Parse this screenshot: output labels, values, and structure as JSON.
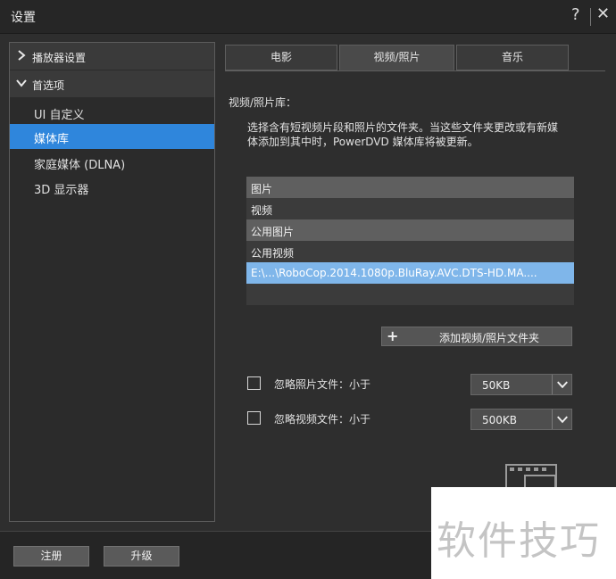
{
  "window": {
    "title": "设置",
    "help_glyph": "?",
    "close_glyph": "✕"
  },
  "sidebar": {
    "groups": [
      {
        "label": "播放器设置",
        "expanded": false
      },
      {
        "label": "首选项",
        "expanded": true
      }
    ],
    "items": [
      {
        "label": "UI 自定义",
        "selected": false
      },
      {
        "label": "媒体库",
        "selected": true
      },
      {
        "label": "家庭媒体 (DLNA)",
        "selected": false
      },
      {
        "label": "3D 显示器",
        "selected": false
      }
    ]
  },
  "tabs": [
    {
      "label": "电影",
      "active": false
    },
    {
      "label": "视频/照片",
      "active": true
    },
    {
      "label": "音乐",
      "active": false
    }
  ],
  "library": {
    "heading": "视频/照片库：",
    "desc_line1": "选择含有短视频片段和照片的文件夹。当这些文件夹更改或有新媒",
    "desc_line2": "体添加到其中时，PowerDVD 媒体库将被更新。",
    "folders": [
      "图片",
      "视频",
      "公用图片",
      "公用视频",
      "E:\\...\\RoboCop.2014.1080p.BluRay.AVC.DTS-HD.MA...."
    ],
    "selected_folder": 4,
    "add_button": "添加视频/照片文件夹"
  },
  "filters": {
    "photo": {
      "label": "忽略照片文件：小于",
      "checked": false,
      "value": "50KB"
    },
    "video": {
      "label": "忽略视频文件：小于",
      "checked": false,
      "value": "500KB"
    }
  },
  "footer": {
    "register": "注册",
    "upgrade": "升级"
  },
  "watermark": "软件技巧",
  "colors": {
    "accent": "#2f86dc",
    "selected_row": "#7fb6ea"
  }
}
